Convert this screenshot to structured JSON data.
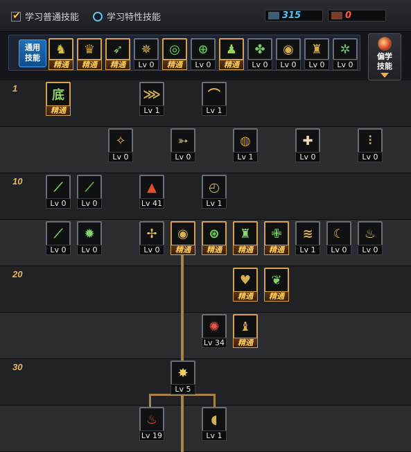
{
  "topbar": {
    "tab_normal": "学习普通技能",
    "tab_trait": "学习特性技能",
    "sp_blue": "315",
    "sp_red": "0",
    "colors": {
      "blue": "#4fc3ff",
      "red": "#ff5a3a"
    }
  },
  "common": {
    "label": "通用技能",
    "skills": [
      {
        "icon": "rider-icon",
        "glyph": "♞",
        "color": "#d8c24a",
        "level": "精通",
        "elite": true
      },
      {
        "icon": "beast-icon",
        "glyph": "♛",
        "color": "#c7a03a",
        "level": "精通",
        "elite": true
      },
      {
        "icon": "dash-icon",
        "glyph": "➶",
        "color": "#7fd36a",
        "level": "精通",
        "elite": true
      },
      {
        "icon": "wings-icon",
        "glyph": "✵",
        "color": "#d8b054",
        "level": "Lv 0",
        "elite": false
      },
      {
        "icon": "target-icon",
        "glyph": "◎",
        "color": "#6fd46a",
        "level": "精通",
        "elite": true
      },
      {
        "icon": "crosshair-icon",
        "glyph": "⊕",
        "color": "#5fb85a",
        "level": "Lv 0",
        "elite": false
      },
      {
        "icon": "leap-icon",
        "glyph": "♟",
        "color": "#9bd05e",
        "level": "精通",
        "elite": true
      },
      {
        "icon": "brain-icon",
        "glyph": "✤",
        "color": "#7ec86a",
        "level": "Lv 0",
        "elite": false
      },
      {
        "icon": "eye-icon",
        "glyph": "◉",
        "color": "#d7b24a",
        "level": "Lv 0",
        "elite": false
      },
      {
        "icon": "muscle-icon",
        "glyph": "♜",
        "color": "#d4aa44",
        "level": "Lv 0",
        "elite": false
      },
      {
        "icon": "whirl-icon",
        "glyph": "✲",
        "color": "#6dc07a",
        "level": "Lv 0",
        "elite": false
      }
    ]
  },
  "side_button": {
    "label": "偏学技能"
  },
  "tree": {
    "rows": [
      {
        "tick": "1"
      },
      {
        "tick": ""
      },
      {
        "tick": "10"
      },
      {
        "tick": ""
      },
      {
        "tick": "20"
      },
      {
        "tick": ""
      },
      {
        "tick": "30"
      },
      {
        "tick": ""
      }
    ],
    "skills": [
      {
        "row": 0,
        "col": 0,
        "icon": "base-icon",
        "glyph": "底",
        "color": "#8fd36a",
        "level": "精通",
        "elite": true
      },
      {
        "row": 0,
        "col": 3,
        "icon": "claw-icon",
        "glyph": "⋙",
        "color": "#d8b054",
        "level": "Lv 1",
        "elite": false
      },
      {
        "row": 0,
        "col": 5,
        "icon": "slash-icon",
        "glyph": "⌒",
        "color": "#d8b054",
        "level": "Lv 1",
        "elite": false
      },
      {
        "row": 1,
        "col": 2,
        "icon": "wing-icon",
        "glyph": "✧",
        "color": "#d8b054",
        "level": "Lv 0",
        "elite": false
      },
      {
        "row": 1,
        "col": 4,
        "icon": "arrow-icon",
        "glyph": "➳",
        "color": "#e0c060",
        "level": "Lv 0",
        "elite": false
      },
      {
        "row": 1,
        "col": 6,
        "icon": "vortex-icon",
        "glyph": "◍",
        "color": "#c89a3a",
        "level": "Lv 1",
        "elite": false
      },
      {
        "row": 1,
        "col": 8,
        "icon": "shield-icon",
        "glyph": "✚",
        "color": "#f0e0b0",
        "level": "Lv 0",
        "elite": false
      },
      {
        "row": 1,
        "col": 10,
        "icon": "triple-icon",
        "glyph": "⫶",
        "color": "#d8b054",
        "level": "Lv 0",
        "elite": false
      },
      {
        "row": 2,
        "col": 0,
        "icon": "blade-icon",
        "glyph": "⟋",
        "color": "#79c95a",
        "level": "Lv 0",
        "elite": false
      },
      {
        "row": 2,
        "col": 1,
        "icon": "blade2-icon",
        "glyph": "⟋",
        "color": "#62b24a",
        "level": "Lv 0",
        "elite": false
      },
      {
        "row": 2,
        "col": 3,
        "icon": "flame-icon",
        "glyph": "▲",
        "color": "#e0502a",
        "level": "Lv 41",
        "elite": false
      },
      {
        "row": 2,
        "col": 5,
        "icon": "spiral-icon",
        "glyph": "◴",
        "color": "#d8b054",
        "level": "Lv 1",
        "elite": false
      },
      {
        "row": 3,
        "col": 0,
        "icon": "sword-icon",
        "glyph": "⟋",
        "color": "#6cc85a",
        "level": "Lv 0",
        "elite": false
      },
      {
        "row": 3,
        "col": 1,
        "icon": "burst-icon",
        "glyph": "✹",
        "color": "#7ed86a",
        "level": "Lv 0",
        "elite": false
      },
      {
        "row": 3,
        "col": 3,
        "icon": "spark-icon",
        "glyph": "✢",
        "color": "#e0c060",
        "level": "Lv 0",
        "elite": false
      },
      {
        "row": 3,
        "col": 4,
        "icon": "aura-icon",
        "glyph": "◉",
        "color": "#d8b054",
        "level": "精通",
        "elite": true
      },
      {
        "row": 3,
        "col": 5,
        "icon": "cell-icon",
        "glyph": "⊛",
        "color": "#7ed86a",
        "level": "精通",
        "elite": true
      },
      {
        "row": 3,
        "col": 6,
        "icon": "strong-icon",
        "glyph": "♜",
        "color": "#8ad870",
        "level": "精通",
        "elite": true
      },
      {
        "row": 3,
        "col": 7,
        "icon": "cross-icon",
        "glyph": "✙",
        "color": "#7fd36a",
        "level": "精通",
        "elite": true
      },
      {
        "row": 3,
        "col": 8,
        "icon": "wave-icon",
        "glyph": "≋",
        "color": "#d8b054",
        "level": "Lv 1",
        "elite": false
      },
      {
        "row": 3,
        "col": 9,
        "icon": "crescent-icon",
        "glyph": "☾",
        "color": "#d8b054",
        "level": "Lv 0",
        "elite": false
      },
      {
        "row": 3,
        "col": 10,
        "icon": "fire-icon",
        "glyph": "♨",
        "color": "#e0c060",
        "level": "Lv 0",
        "elite": false
      },
      {
        "row": 4,
        "col": 6,
        "icon": "heart-icon",
        "glyph": "♥",
        "color": "#d8b054",
        "level": "精通",
        "elite": true
      },
      {
        "row": 4,
        "col": 7,
        "icon": "wind-icon",
        "glyph": "❦",
        "color": "#7fd36a",
        "level": "精通",
        "elite": true
      },
      {
        "row": 5,
        "col": 5,
        "icon": "roar-icon",
        "glyph": "✺",
        "color": "#e05a4a",
        "level": "Lv 34",
        "elite": false
      },
      {
        "row": 5,
        "col": 6,
        "icon": "summon-icon",
        "glyph": "♝",
        "color": "#d8b054",
        "level": "精通",
        "elite": true
      },
      {
        "row": 6,
        "col": 4,
        "icon": "explode-icon",
        "glyph": "✸",
        "color": "#f0d060",
        "level": "Lv 5",
        "elite": false
      },
      {
        "row": 7,
        "col": 3,
        "icon": "inferno-icon",
        "glyph": "♨",
        "color": "#e0502a",
        "level": "Lv 19",
        "elite": false
      },
      {
        "row": 7,
        "col": 5,
        "icon": "horn-icon",
        "glyph": "◖",
        "color": "#d8b054",
        "level": "Lv 1",
        "elite": false
      }
    ]
  }
}
